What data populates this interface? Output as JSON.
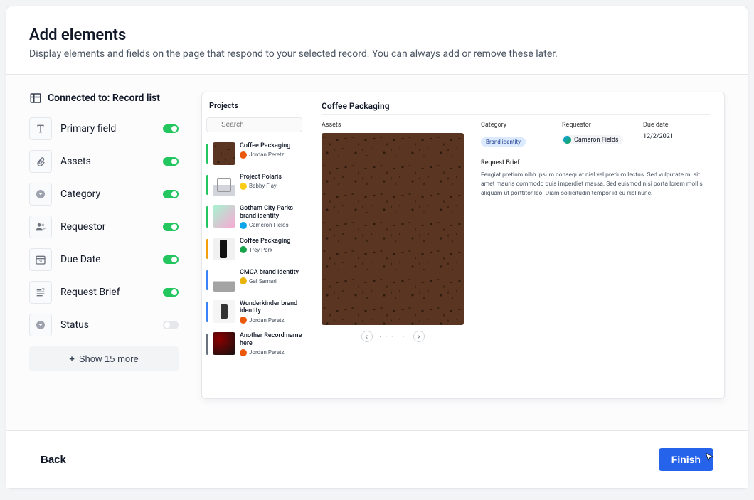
{
  "header": {
    "title": "Add elements",
    "subtitle": "Display elements and fields on the page that respond to your selected record. You can always add or remove these later."
  },
  "connected_label": "Connected to: Record list",
  "fields": [
    {
      "label": "Primary field",
      "on": true,
      "icon": "text"
    },
    {
      "label": "Assets",
      "on": true,
      "icon": "attach"
    },
    {
      "label": "Category",
      "on": true,
      "icon": "select"
    },
    {
      "label": "Requestor",
      "on": true,
      "icon": "person"
    },
    {
      "label": "Due Date",
      "on": true,
      "icon": "date"
    },
    {
      "label": "Request Brief",
      "on": true,
      "icon": "longtext"
    },
    {
      "label": "Status",
      "on": false,
      "icon": "select"
    }
  ],
  "show_more_label": "Show 15 more",
  "preview": {
    "left_title": "Projects",
    "search_placeholder": "Search",
    "records": [
      {
        "name": "Coffee Packaging",
        "person": "Jordan Peretz",
        "bar": "#22c55e",
        "thumb": "t-coffee beans",
        "dot": "#ea580c"
      },
      {
        "name": "Project Polaris",
        "person": "Bobby Flay",
        "bar": "#22c55e",
        "thumb": "t-polaris",
        "dot": "#facc15"
      },
      {
        "name": "Gotham City Parks brand identity",
        "person": "Cameron Fields",
        "bar": "#22c55e",
        "thumb": "t-parks",
        "dot": "#0ea5e9"
      },
      {
        "name": "Coffee Packaging",
        "person": "Trey Park",
        "bar": "#f59e0b",
        "thumb": "t-phone",
        "dot": "#16a34a"
      },
      {
        "name": "CMCA brand identity",
        "person": "Gal Samari",
        "bar": "#3b82f6",
        "thumb": "t-cmca",
        "dot": "#eab308"
      },
      {
        "name": "Wunderkinder brand identity",
        "person": "Jordan Peretz",
        "bar": "#3b82f6",
        "thumb": "t-wund",
        "dot": "#ea580c"
      },
      {
        "name": "Another Record name here",
        "person": "Jordan Peretz",
        "bar": "#6b7280",
        "thumb": "t-dark",
        "dot": "#ea580c"
      }
    ],
    "detail": {
      "title": "Coffee Packaging",
      "assets_label": "Assets",
      "category_label": "Category",
      "category_value": "Brand identity",
      "requestor_label": "Requestor",
      "requestor_value": "Cameron Fields",
      "due_label": "Due date",
      "due_value": "12/2/2021",
      "brief_label": "Request Brief",
      "brief_text": "Feugiat pretium nibh ipsum consequat nisl vel pretium lectus. Sed vulputate mi sit amet mauris commodo quis imperdiet massa. Sed euismod nisi porta lorem mollis aliquam ut porttitor leo. Diam sollicitudin tempor id eu nisl nunc."
    }
  },
  "footer": {
    "back": "Back",
    "finish": "Finish"
  }
}
